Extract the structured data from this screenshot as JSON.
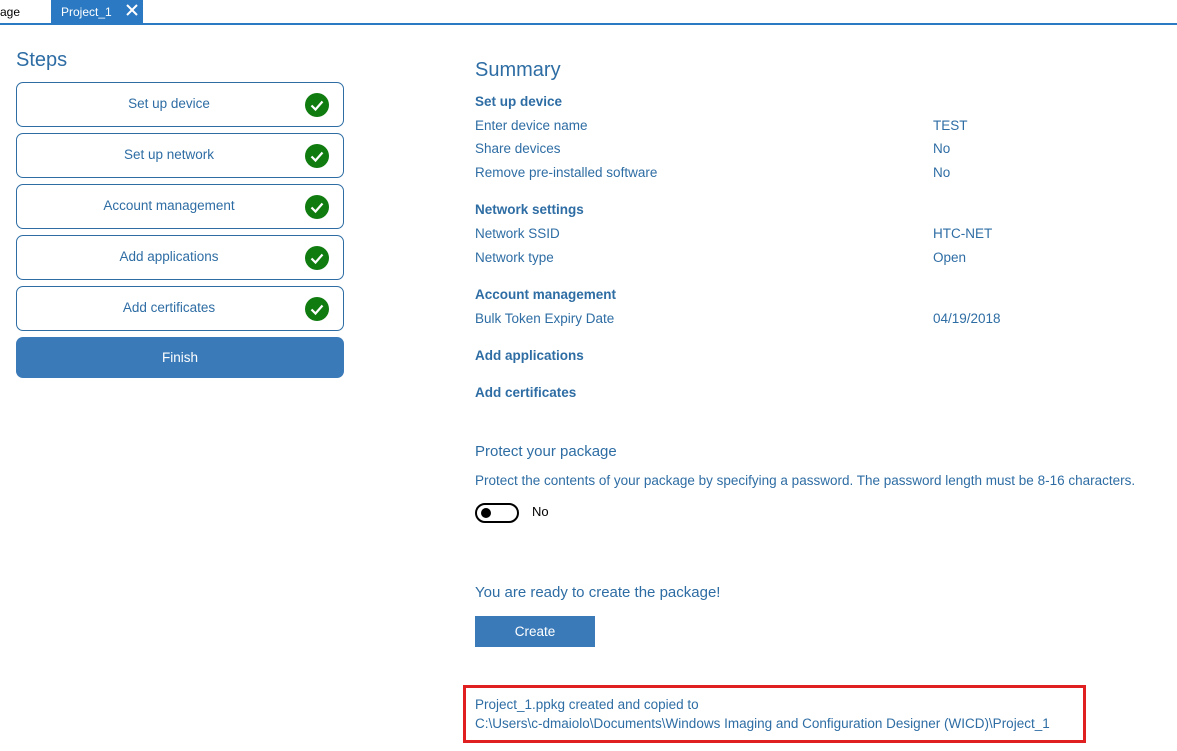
{
  "tabs": {
    "prev_label": "age",
    "active_label": "Project_1"
  },
  "steps": {
    "title": "Steps",
    "items": [
      {
        "label": "Set up device"
      },
      {
        "label": "Set up network"
      },
      {
        "label": "Account management"
      },
      {
        "label": "Add applications"
      },
      {
        "label": "Add certificates"
      }
    ],
    "finish_label": "Finish"
  },
  "summary": {
    "title": "Summary",
    "device": {
      "heading": "Set up device",
      "rows": [
        {
          "label": "Enter device name",
          "value": "TEST"
        },
        {
          "label": "Share devices",
          "value": "No"
        },
        {
          "label": "Remove pre-installed software",
          "value": "No"
        }
      ]
    },
    "network": {
      "heading": "Network settings",
      "rows": [
        {
          "label": "Network SSID",
          "value": "HTC-NET"
        },
        {
          "label": "Network type",
          "value": "Open"
        }
      ]
    },
    "account": {
      "heading": "Account management",
      "rows": [
        {
          "label": "Bulk Token Expiry Date",
          "value": "04/19/2018"
        }
      ]
    },
    "applications": {
      "heading": "Add applications"
    },
    "certificates": {
      "heading": "Add certificates"
    }
  },
  "protect": {
    "title": "Protect your package",
    "description": "Protect the contents of your package by specifying a password. The password length must be 8-16 characters.",
    "toggle_label": "No"
  },
  "create": {
    "ready_text": "You are ready to create the package!",
    "button_label": "Create",
    "result_line1": "Project_1.ppkg created and copied to",
    "result_line2": "C:\\Users\\c-dmaiolo\\Documents\\Windows Imaging and Configuration Designer (WICD)\\Project_1"
  },
  "colors": {
    "accent": "#2b79c2",
    "text": "#2e6da4",
    "check": "#107c10",
    "highlight": "#e02020"
  }
}
